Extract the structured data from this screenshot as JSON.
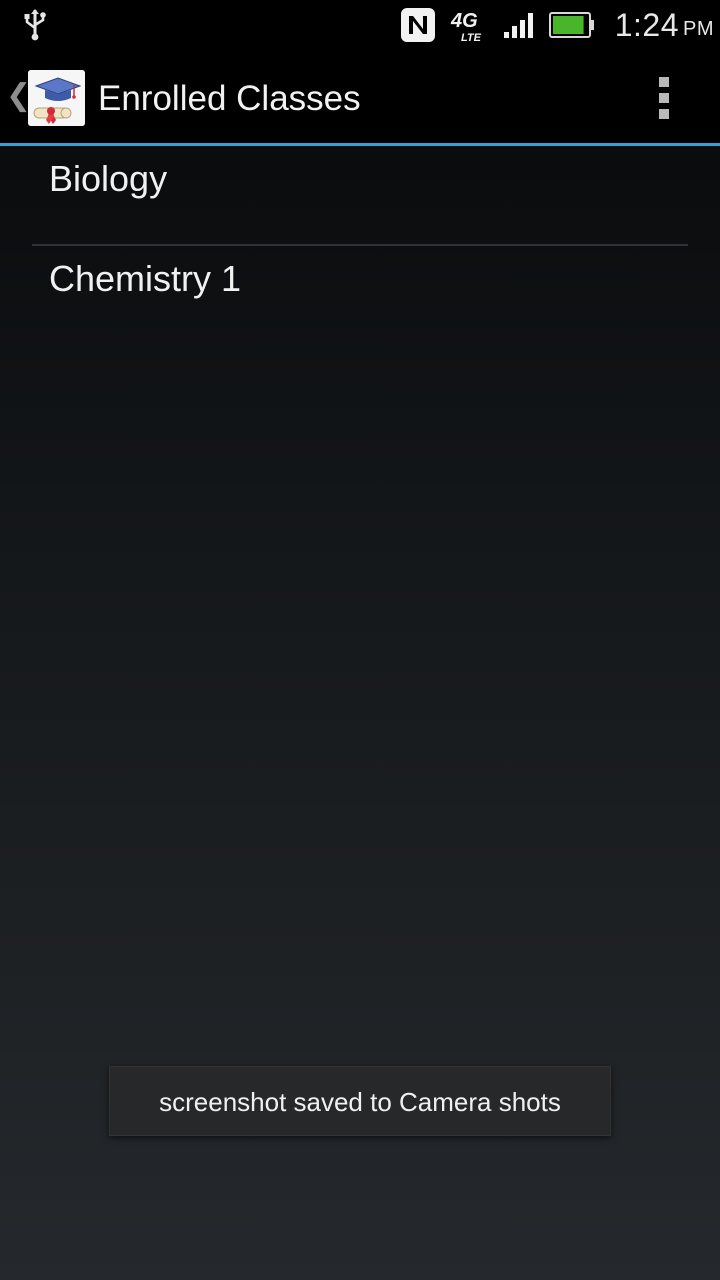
{
  "status_bar": {
    "time": "1:24",
    "ampm": "PM",
    "network_label": "4G",
    "network_sub": "LTE",
    "icons": [
      "usb-icon",
      "nfc-icon",
      "4g-lte-icon",
      "signal-icon",
      "battery-icon"
    ],
    "battery_level": 0.9
  },
  "action_bar": {
    "title": "Enrolled Classes",
    "accent_color": "#33a1d6"
  },
  "classes": {
    "items": [
      {
        "label": "Biology"
      },
      {
        "label": "Chemistry 1"
      }
    ]
  },
  "toast": {
    "message": "screenshot saved to Camera shots"
  }
}
